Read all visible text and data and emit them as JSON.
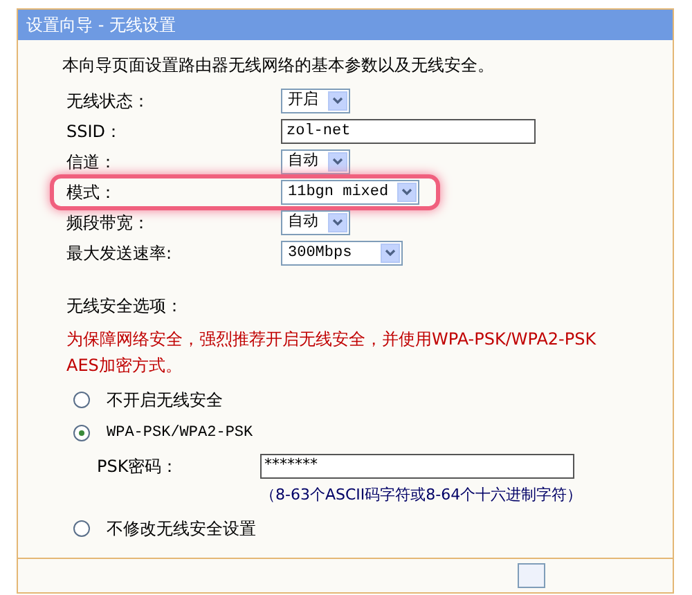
{
  "window": {
    "title": "设置向导 - 无线设置"
  },
  "intro": "本向导页面设置路由器无线网络的基本参数以及无线安全。",
  "fields": [
    {
      "label": "无线状态：",
      "kind": "select",
      "value": "开启"
    },
    {
      "label": "SSID：",
      "kind": "text",
      "value": "zol-net"
    },
    {
      "label": "信道：",
      "kind": "select",
      "value": "自动"
    },
    {
      "label": "模式：",
      "kind": "select",
      "value": "11bgn mixed",
      "highlighted": true
    },
    {
      "label": "频段带宽：",
      "kind": "select",
      "value": "自动"
    },
    {
      "label": "最大发送速率:",
      "kind": "select",
      "value": "300Mbps"
    }
  ],
  "security": {
    "title": "无线安全选项：",
    "warning": "为保障网络安全，强烈推荐开启无线安全，并使用WPA-PSK/WPA2-PSK AES加密方式。",
    "options": [
      {
        "label": "不开启无线安全",
        "selected": false
      },
      {
        "label": "WPA-PSK/WPA2-PSK",
        "selected": true,
        "password_label": "PSK密码：",
        "password_value": "*******",
        "hint": "（8-63个ASCII码字符或8-64个十六进制字符）"
      },
      {
        "label": "不修改无线安全设置",
        "selected": false
      }
    ]
  }
}
